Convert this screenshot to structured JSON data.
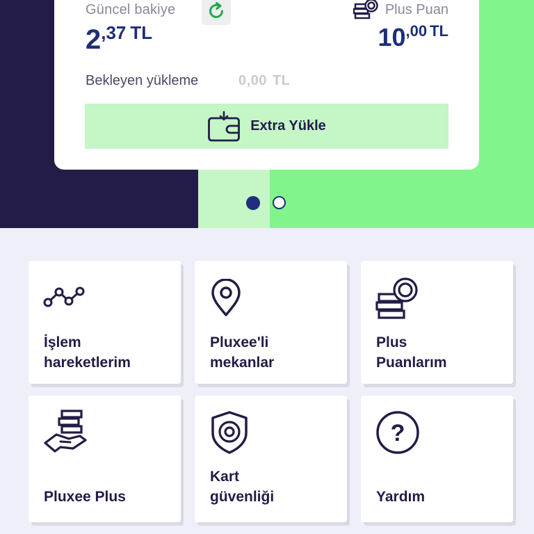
{
  "balance_card": {
    "current_label": "Güncel bakiye",
    "current_int": "2",
    "current_dec": ",37",
    "currency": "TL",
    "points_label": "Plus Puan",
    "points_int": "10",
    "points_dec": ",00",
    "points_currency": "TL",
    "pending_label": "Bekleyen yükleme",
    "pending_amount": "0,00",
    "pending_currency": "TL",
    "topup_label": "Extra Yükle"
  },
  "carousel": {
    "page_count": 2,
    "active_index": 0
  },
  "tiles": [
    {
      "line1": "İşlem",
      "line2": "hareketlerim",
      "icon": "transactions-chart-icon"
    },
    {
      "line1": "Pluxee'li",
      "line2": "mekanlar",
      "icon": "location-pin-icon"
    },
    {
      "line1": "Plus",
      "line2": "Puanlarım",
      "icon": "coins-stack-icon"
    },
    {
      "line1": "Pluxee Plus",
      "line2": "",
      "icon": "hand-coins-icon"
    },
    {
      "line1": "Kart",
      "line2": "güvenliği",
      "icon": "shield-eye-icon"
    },
    {
      "line1": "Yardım",
      "line2": "",
      "icon": "help-circle-icon"
    }
  ],
  "colors": {
    "navy": "#221c46",
    "accent_blue": "#1f2e7a",
    "mint": "#c4f6c6",
    "green": "#81f58c",
    "refresh_green": "#26a64c"
  }
}
